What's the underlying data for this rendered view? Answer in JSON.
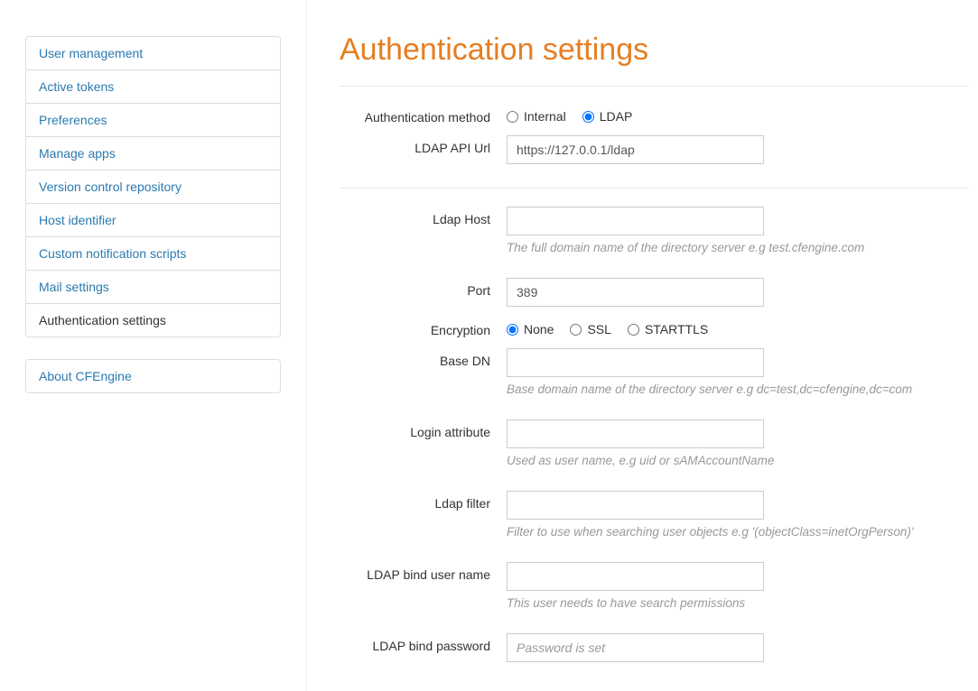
{
  "sidebar": {
    "group1": [
      {
        "label": "User management",
        "active": false
      },
      {
        "label": "Active tokens",
        "active": false
      },
      {
        "label": "Preferences",
        "active": false
      },
      {
        "label": "Manage apps",
        "active": false
      },
      {
        "label": "Version control repository",
        "active": false
      },
      {
        "label": "Host identifier",
        "active": false
      },
      {
        "label": "Custom notification scripts",
        "active": false
      },
      {
        "label": "Mail settings",
        "active": false
      },
      {
        "label": "Authentication settings",
        "active": true
      }
    ],
    "group2": [
      {
        "label": "About CFEngine",
        "active": false
      }
    ]
  },
  "page": {
    "title": "Authentication settings"
  },
  "form": {
    "auth_method": {
      "label": "Authentication method",
      "options": {
        "internal": "Internal",
        "ldap": "LDAP"
      },
      "selected": "ldap"
    },
    "ldap_api_url": {
      "label": "LDAP API Url",
      "value": "https://127.0.0.1/ldap"
    },
    "ldap_host": {
      "label": "Ldap Host",
      "value": "",
      "hint": "The full domain name of the directory server e.g test.cfengine.com"
    },
    "port": {
      "label": "Port",
      "value": "389"
    },
    "encryption": {
      "label": "Encryption",
      "options": {
        "none": "None",
        "ssl": "SSL",
        "starttls": "STARTTLS"
      },
      "selected": "none"
    },
    "base_dn": {
      "label": "Base DN",
      "value": "",
      "hint": "Base domain name of the directory server e.g dc=test,dc=cfengine,dc=com"
    },
    "login_attr": {
      "label": "Login attribute",
      "value": "",
      "hint": "Used as user name, e.g uid or sAMAccountName"
    },
    "ldap_filter": {
      "label": "Ldap filter",
      "value": "",
      "hint": "Filter to use when searching user objects e.g '(objectClass=inetOrgPerson)'"
    },
    "bind_user": {
      "label": "LDAP bind user name",
      "value": "",
      "hint": "This user needs to have search permissions"
    },
    "bind_pass": {
      "label": "LDAP bind password",
      "placeholder": "Password is set",
      "value": ""
    }
  }
}
